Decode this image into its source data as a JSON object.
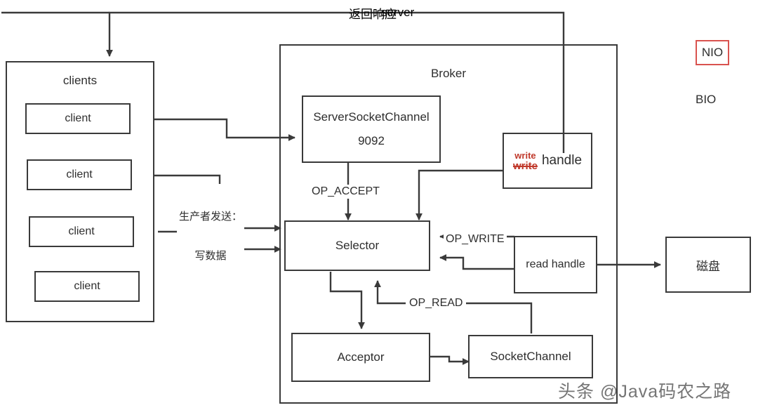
{
  "diagram": {
    "title_overlap": {
      "chinese": "返回响应",
      "english": "server"
    },
    "clients_panel": {
      "title": "clients",
      "items": [
        {
          "label": "client"
        },
        {
          "label": "client"
        },
        {
          "label": "client"
        },
        {
          "label": "client"
        }
      ]
    },
    "broker_panel": {
      "title": "Broker"
    },
    "boxes": {
      "server_socket_channel": {
        "line1": "ServerSocketChannel",
        "line2": "9092"
      },
      "write_handle": {
        "red_top": "write",
        "red_strike": "write",
        "word": "handle"
      },
      "selector": {
        "label": "Selector"
      },
      "read_handle": {
        "label": "read handle"
      },
      "disk": {
        "label": "磁盘"
      },
      "acceptor": {
        "label": "Acceptor"
      },
      "socket_channel": {
        "label": "SocketChannel"
      }
    },
    "edge_labels": {
      "op_accept": "OP_ACCEPT",
      "op_write": "OP_WRITE",
      "op_read": "OP_READ",
      "producer_send_line1": "生产者发送：",
      "producer_send_line2": "写数据"
    },
    "legend": {
      "nio": "NIO",
      "bio": "BIO"
    },
    "watermark": "头条 @Java码农之路",
    "colors": {
      "stroke": "#3a3a3a",
      "text": "#2e2e2e",
      "accent_red": "#d9534f",
      "strike_red": "#c0392b",
      "watermark": "#6a6a6a"
    }
  }
}
